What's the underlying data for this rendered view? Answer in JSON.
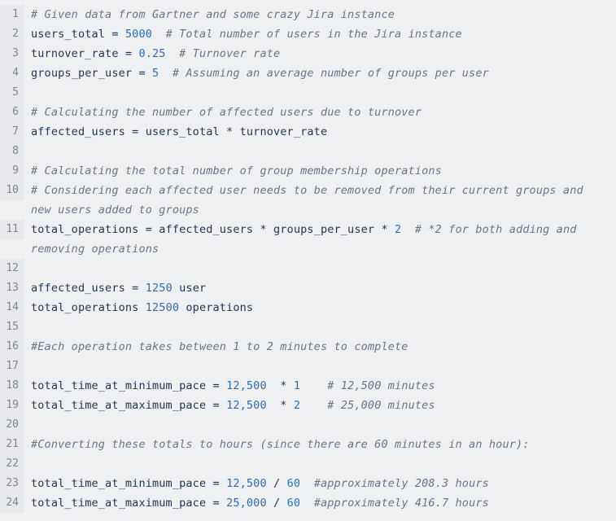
{
  "editor": {
    "language": "python",
    "colors": {
      "background": "#eff0f2",
      "gutter_background": "#e6e8eb",
      "gutter_text": "#7a8699",
      "code_text": "#1f3256",
      "number_literal": "#2a6ebb",
      "comment": "#67758c"
    },
    "first_line_number": 1,
    "last_line_number": 24,
    "lines": [
      {
        "number": "1",
        "tokens": [
          {
            "t": "comment",
            "s": "# Given data from Gartner and some crazy Jira instance"
          }
        ]
      },
      {
        "number": "2",
        "tokens": [
          {
            "t": "plain",
            "s": "users_total = "
          },
          {
            "t": "num",
            "s": "5000"
          },
          {
            "t": "plain",
            "s": "  "
          },
          {
            "t": "comment",
            "s": "# Total number of users in the Jira instance"
          }
        ]
      },
      {
        "number": "3",
        "tokens": [
          {
            "t": "plain",
            "s": "turnover_rate = "
          },
          {
            "t": "num",
            "s": "0.25"
          },
          {
            "t": "plain",
            "s": "  "
          },
          {
            "t": "comment",
            "s": "# Turnover rate"
          }
        ]
      },
      {
        "number": "4",
        "tokens": [
          {
            "t": "plain",
            "s": "groups_per_user = "
          },
          {
            "t": "num",
            "s": "5"
          },
          {
            "t": "plain",
            "s": "  "
          },
          {
            "t": "comment",
            "s": "# Assuming an average number of groups per user"
          }
        ]
      },
      {
        "number": "5",
        "tokens": []
      },
      {
        "number": "6",
        "tokens": [
          {
            "t": "comment",
            "s": "# Calculating the number of affected users due to turnover"
          }
        ]
      },
      {
        "number": "7",
        "tokens": [
          {
            "t": "plain",
            "s": "affected_users = users_total * turnover_rate"
          }
        ]
      },
      {
        "number": "8",
        "tokens": []
      },
      {
        "number": "9",
        "tokens": [
          {
            "t": "comment",
            "s": "# Calculating the total number of group membership operations"
          }
        ]
      },
      {
        "number": "10",
        "tokens": [
          {
            "t": "comment",
            "s": "# Considering each affected user needs to be removed from their current groups and new users added to groups"
          }
        ]
      },
      {
        "number": "11",
        "tokens": [
          {
            "t": "plain",
            "s": "total_operations = affected_users * groups_per_user * "
          },
          {
            "t": "num",
            "s": "2"
          },
          {
            "t": "plain",
            "s": "  "
          },
          {
            "t": "comment",
            "s": "# *2 for both adding and removing operations"
          }
        ]
      },
      {
        "number": "12",
        "tokens": []
      },
      {
        "number": "13",
        "tokens": [
          {
            "t": "plain",
            "s": "affected_users = "
          },
          {
            "t": "num",
            "s": "1250"
          },
          {
            "t": "plain",
            "s": " user"
          }
        ]
      },
      {
        "number": "14",
        "tokens": [
          {
            "t": "plain",
            "s": "total_operations "
          },
          {
            "t": "num",
            "s": "12500"
          },
          {
            "t": "plain",
            "s": " operations"
          }
        ]
      },
      {
        "number": "15",
        "tokens": []
      },
      {
        "number": "16",
        "tokens": [
          {
            "t": "comment",
            "s": "#Each operation takes between 1 to 2 minutes to complete"
          }
        ]
      },
      {
        "number": "17",
        "tokens": []
      },
      {
        "number": "18",
        "tokens": [
          {
            "t": "plain",
            "s": "total_time_at_minimum_pace = "
          },
          {
            "t": "num",
            "s": "12,500"
          },
          {
            "t": "plain",
            "s": "  * "
          },
          {
            "t": "num",
            "s": "1"
          },
          {
            "t": "plain",
            "s": "    "
          },
          {
            "t": "comment",
            "s": "# 12,500 minutes"
          }
        ]
      },
      {
        "number": "19",
        "tokens": [
          {
            "t": "plain",
            "s": "total_time_at_maximum_pace = "
          },
          {
            "t": "num",
            "s": "12,500"
          },
          {
            "t": "plain",
            "s": "  * "
          },
          {
            "t": "num",
            "s": "2"
          },
          {
            "t": "plain",
            "s": "    "
          },
          {
            "t": "comment",
            "s": "# 25,000 minutes"
          }
        ]
      },
      {
        "number": "20",
        "tokens": []
      },
      {
        "number": "21",
        "tokens": [
          {
            "t": "comment",
            "s": "#Converting these totals to hours (since there are 60 minutes in an hour):"
          }
        ]
      },
      {
        "number": "22",
        "tokens": []
      },
      {
        "number": "23",
        "tokens": [
          {
            "t": "plain",
            "s": "total_time_at_minimum_pace = "
          },
          {
            "t": "num",
            "s": "12,500"
          },
          {
            "t": "plain",
            "s": " / "
          },
          {
            "t": "num",
            "s": "60"
          },
          {
            "t": "plain",
            "s": "  "
          },
          {
            "t": "comment",
            "s": "#approximately 208.3 hours"
          }
        ]
      },
      {
        "number": "24",
        "tokens": [
          {
            "t": "plain",
            "s": "total_time_at_maximum_pace = "
          },
          {
            "t": "num",
            "s": "25,000"
          },
          {
            "t": "plain",
            "s": " / "
          },
          {
            "t": "num",
            "s": "60"
          },
          {
            "t": "plain",
            "s": "  "
          },
          {
            "t": "comment",
            "s": "#approximately 416.7 hours"
          }
        ]
      }
    ]
  }
}
